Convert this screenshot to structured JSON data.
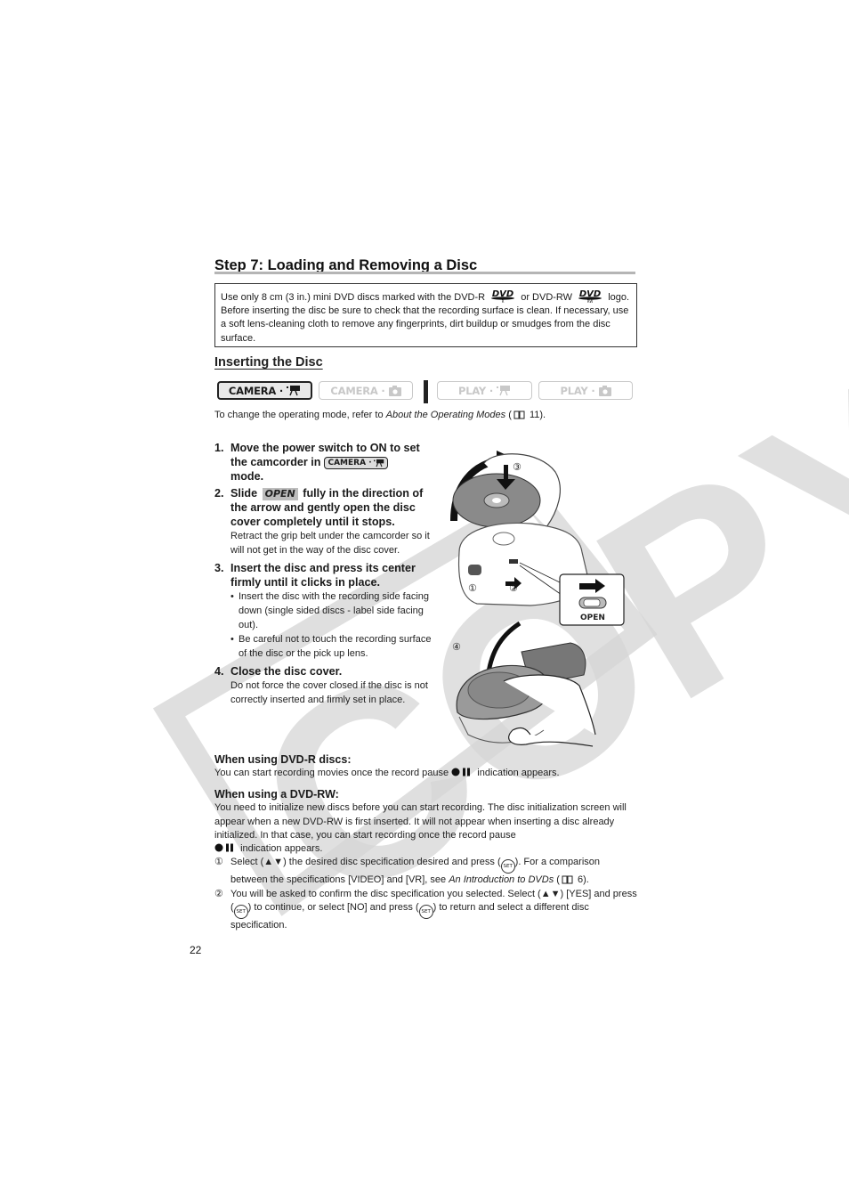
{
  "page": {
    "title": "Step 7: Loading and Removing a Disc",
    "page_number": "22",
    "watermark": "COPY"
  },
  "notice": {
    "text_1": "Use only 8 cm (3 in.) mini DVD discs marked with the DVD-R",
    "text_2": "or DVD-RW",
    "text_3": "logo. Before inserting the disc be sure to check that the recording surface is clean. If necessary, use a soft lens-cleaning cloth to remove any fingerprints, dirt buildup or smudges from the disc surface.",
    "logo_r_label": "DVD",
    "logo_r_sub": "R",
    "logo_rw_label": "DVD",
    "logo_rw_sub": "RW"
  },
  "section": {
    "heading": "Inserting the Disc",
    "modes": [
      {
        "label": "CAMERA ·",
        "icon": "movie-camera-icon",
        "active": true
      },
      {
        "label": "CAMERA ·",
        "icon": "still-camera-icon",
        "active": false
      },
      {
        "label": "PLAY ·",
        "icon": "movie-camera-icon",
        "active": false
      },
      {
        "label": "PLAY ·",
        "icon": "still-camera-icon",
        "active": false
      }
    ],
    "mode_note_prefix": "To change the operating mode, refer to ",
    "mode_note_link": "About the Operating Modes",
    "mode_note_suffix_open": " (",
    "mode_note_page": " 11)."
  },
  "steps": [
    {
      "num": "1.",
      "title_a": "Move the power switch to ON to set the camcorder in",
      "inline_mode": "CAMERA ·",
      "title_b": "mode."
    },
    {
      "num": "2.",
      "title_a": "Slide",
      "inline_chip": "OPEN",
      "title_b": "fully in the direction of the arrow and gently open the disc cover completely until it stops.",
      "body": "Retract the grip belt under the camcorder so it will not get in the way of the disc cover."
    },
    {
      "num": "3.",
      "title": "Insert the disc and press its center firmly until it clicks in place.",
      "bullets": [
        "Insert the disc with the recording side facing down (single sided discs - label side facing out).",
        "Be careful not to touch the recording surface of the disc or the pick up lens."
      ]
    },
    {
      "num": "4.",
      "title": "Close the disc cover.",
      "body": "Do not force the cover closed if the disc is not correctly inserted and firmly set in place."
    }
  ],
  "illustration": {
    "callouts": [
      "①",
      "②",
      "③",
      "④"
    ],
    "switch_label": "OPEN"
  },
  "dvd_r": {
    "heading": "When using DVD-R discs:",
    "text_a": "You can start recording movies once the record pause",
    "text_b": "indication appears."
  },
  "dvd_rw": {
    "heading": "When using a DVD-RW:",
    "text_a": "You need to initialize new discs before you can start recording. The disc initialization screen will appear when a new DVD-RW is first inserted. It will not appear when inserting a disc already initialized. In that case, you can start recording once the record pause",
    "text_b": "indication appears.",
    "items": [
      {
        "n": "①",
        "a": "Select (",
        "arrows": "▲▼",
        "b": ") the desired disc specification desired and press (",
        "set": "SET",
        "c": "). For a comparison between the specifications [VIDEO] and [VR], see ",
        "link": "An Introduction to DVDs",
        "d": " (",
        "page": " 6)."
      },
      {
        "n": "②",
        "a": "You will be asked to confirm the disc specification you selected. Select (",
        "arrows": "▲▼",
        "b": ") [YES] and press (",
        "set": "SET",
        "c": ") to continue, or select [NO] and press (",
        "d": ") to return and select a different disc specification."
      }
    ]
  }
}
